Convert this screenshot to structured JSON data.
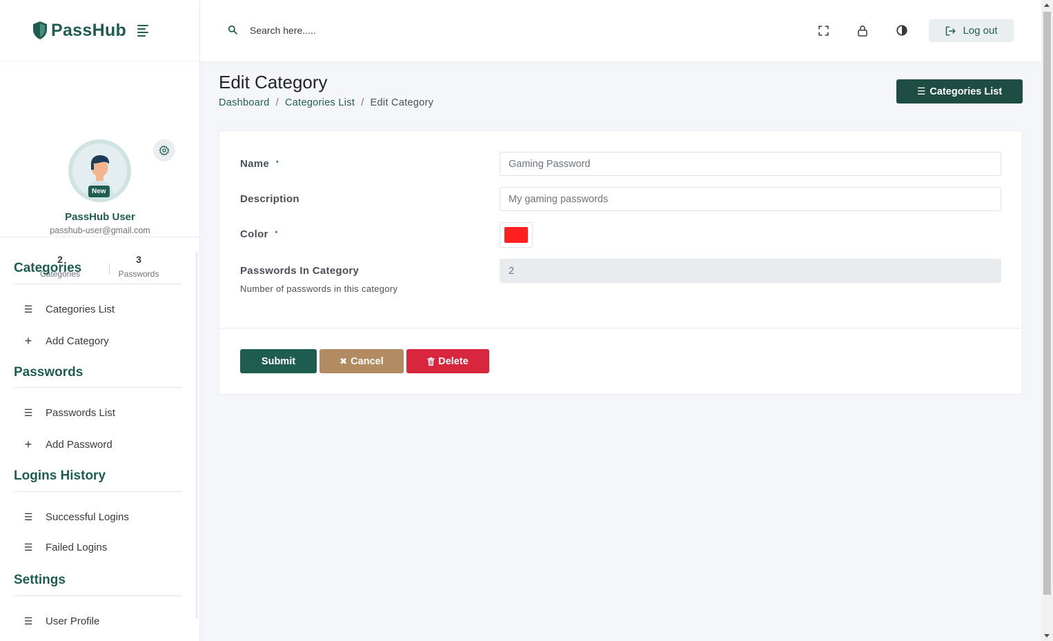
{
  "app": {
    "brand": "PassHub"
  },
  "topbar": {
    "search_placeholder": "Search here.....",
    "logout_label": "Log out"
  },
  "profile": {
    "name": "PassHub User",
    "email": "passhub-user@gmail.com",
    "badge": "New",
    "stats": [
      {
        "value": "2",
        "label": "Categories"
      },
      {
        "value": "3",
        "label": "Passwords"
      }
    ]
  },
  "sidebar": {
    "sections": [
      {
        "title": "Categories",
        "items": [
          {
            "label": "Categories List",
            "icon": "list-icon"
          },
          {
            "label": "Add Category",
            "icon": "plus-icon"
          }
        ]
      },
      {
        "title": "Passwords",
        "items": [
          {
            "label": "Passwords List",
            "icon": "list-icon"
          },
          {
            "label": "Add Password",
            "icon": "plus-icon"
          }
        ]
      },
      {
        "title": "Logins History",
        "items": [
          {
            "label": "Successful Logins",
            "icon": "list-icon"
          },
          {
            "label": "Failed Logins",
            "icon": "list-icon"
          }
        ]
      },
      {
        "title": "Settings",
        "items": [
          {
            "label": "User Profile",
            "icon": "list-icon"
          }
        ]
      }
    ]
  },
  "page": {
    "title": "Edit Category",
    "breadcrumb": [
      "Dashboard",
      "Categories List",
      "Edit Category"
    ],
    "header_button": "Categories List"
  },
  "form": {
    "name": {
      "label": "Name",
      "required_mark": "*",
      "value": "Gaming Password"
    },
    "description": {
      "label": "Description",
      "value": "My gaming passwords"
    },
    "color": {
      "label": "Color",
      "required_mark": "*",
      "value": "#ff1f1f"
    },
    "passwords_in_category": {
      "label": "Passwords In Category",
      "value": "2",
      "help": "Number of passwords in this category"
    },
    "buttons": {
      "submit": "Submit",
      "cancel": "Cancel",
      "delete": "Delete"
    }
  },
  "colors": {
    "primary": "#1f5d50",
    "cancel": "#b38b62",
    "delete": "#d9263f"
  }
}
